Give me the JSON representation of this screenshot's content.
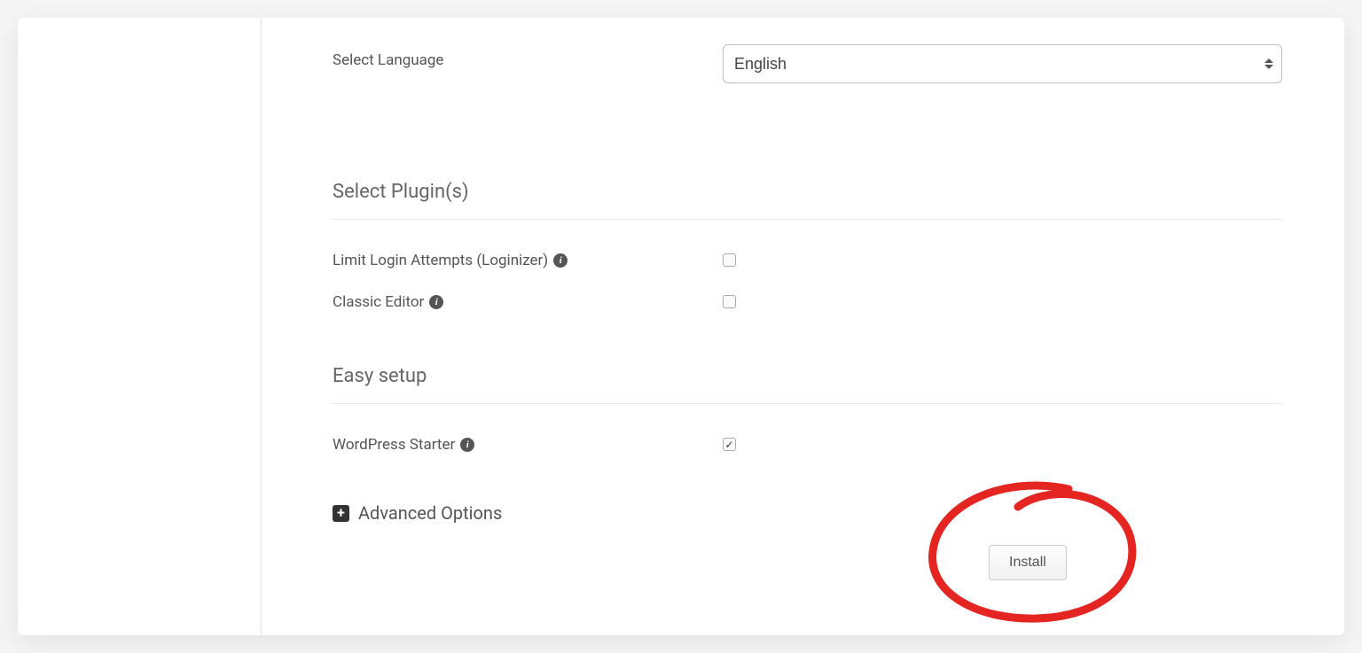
{
  "language": {
    "label": "Select Language",
    "selected": "English"
  },
  "plugins": {
    "heading": "Select Plugin(s)",
    "items": [
      {
        "label": "Limit Login Attempts (Loginizer)",
        "checked": false
      },
      {
        "label": "Classic Editor",
        "checked": false
      }
    ]
  },
  "easy_setup": {
    "heading": "Easy setup",
    "items": [
      {
        "label": "WordPress Starter",
        "checked": true
      }
    ]
  },
  "advanced": {
    "label": "Advanced Options"
  },
  "actions": {
    "install": "Install"
  }
}
